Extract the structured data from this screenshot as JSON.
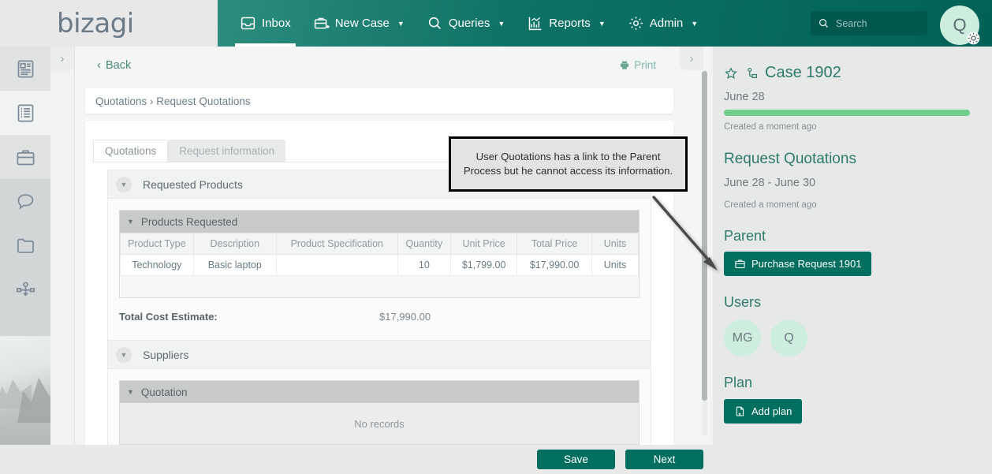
{
  "brand": {
    "logo_text": "bizagi",
    "accent": "#006f5f",
    "nav_gradient_from": "#2c8d7d",
    "nav_gradient_to": "#006157"
  },
  "topnav": {
    "items": [
      {
        "label": "Inbox",
        "icon": "inbox-icon",
        "active": true,
        "has_caret": false
      },
      {
        "label": "New Case",
        "icon": "new-case-icon",
        "active": false,
        "has_caret": true
      },
      {
        "label": "Queries",
        "icon": "search-icon",
        "active": false,
        "has_caret": true
      },
      {
        "label": "Reports",
        "icon": "reports-chart-icon",
        "active": false,
        "has_caret": true
      },
      {
        "label": "Admin",
        "icon": "gear-icon",
        "active": false,
        "has_caret": true
      }
    ],
    "search_placeholder": "Search",
    "search_value": "",
    "avatar_initial": "Q"
  },
  "sidebar": {
    "items": [
      {
        "icon": "cards-document-icon",
        "name": "sidebar-item-cards"
      },
      {
        "icon": "list-icon",
        "name": "sidebar-item-list"
      },
      {
        "icon": "briefcase-icon",
        "name": "sidebar-item-cases"
      },
      {
        "icon": "chat-bubble-icon",
        "name": "sidebar-item-messages"
      },
      {
        "icon": "folder-icon",
        "name": "sidebar-item-documents"
      },
      {
        "icon": "process-flow-icon",
        "name": "sidebar-item-processes"
      }
    ],
    "expand_chevron": "›"
  },
  "main": {
    "back_label": "Back",
    "back_chevron": "‹",
    "print_label": "Print",
    "collapse_chevron": "›",
    "breadcrumb": "Quotations › Request Quotations",
    "tabs": [
      {
        "label": "Quotations",
        "active": true
      },
      {
        "label": "Request information",
        "active": false
      }
    ],
    "sections": {
      "requested_products": {
        "title": "Requested Products",
        "subsection_title": "Products Requested",
        "table": {
          "headers": [
            "Product Type",
            "Description",
            "Product Specification",
            "Quantity",
            "Unit Price",
            "Total Price",
            "Units"
          ],
          "rows": [
            [
              "Technology",
              "Basic laptop",
              "",
              "10",
              "$1,799.00",
              "$17,990.00",
              "Units"
            ]
          ]
        },
        "total_label": "Total Cost Estimate:",
        "total_value": "$17,990.00"
      },
      "suppliers": {
        "title": "Suppliers",
        "subsection_title": "Quotation",
        "empty_text": "No records"
      }
    }
  },
  "footer": {
    "save_label": "Save",
    "next_label": "Next"
  },
  "right_panel": {
    "case_title": "Case 1902",
    "star_icon": "star-icon",
    "process_icon": "process-flow-icon",
    "case_date": "June 28",
    "case_created": "Created a moment ago",
    "progress_percent": 100,
    "progress_color": "#6ece8a",
    "activity_title": "Request Quotations",
    "activity_dates": "June 28 - June 30",
    "activity_created": "Created a moment ago",
    "parent_heading": "Parent",
    "parent_button_label": "Purchase Request 1901",
    "parent_button_icon": "briefcase-icon",
    "users_heading": "Users",
    "users": [
      {
        "initials": "MG"
      },
      {
        "initials": "Q"
      }
    ],
    "plan_heading": "Plan",
    "add_plan_label": "Add plan",
    "add_plan_icon": "document-plus-icon"
  },
  "annotation": {
    "callout_text": "User Quotations has a link to the Parent Process but he cannot access its information.",
    "arrow": "arrow-pointing-to-parent-button"
  }
}
